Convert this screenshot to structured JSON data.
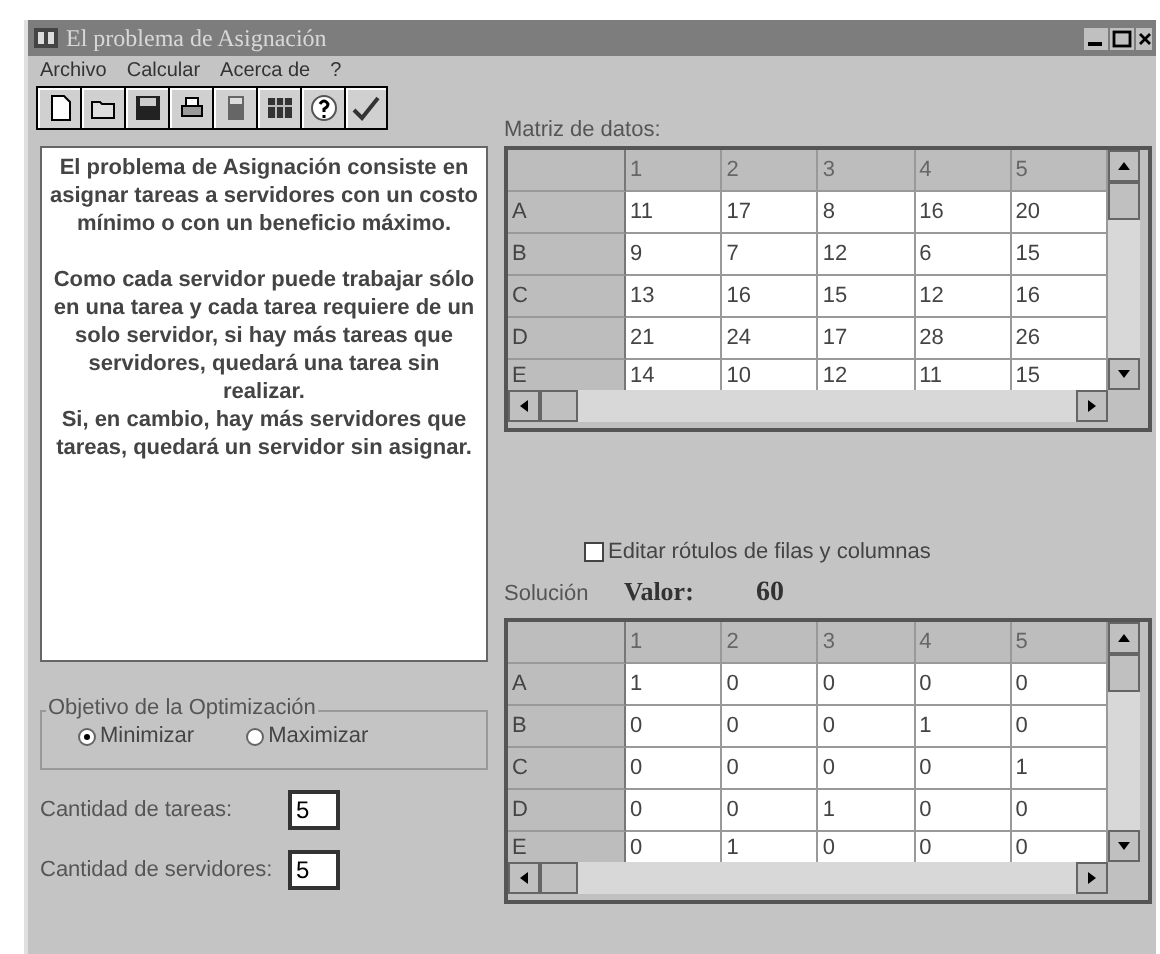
{
  "window": {
    "title": "El problema de Asignación"
  },
  "menu": [
    {
      "label": "Archivo"
    },
    {
      "label": "Calcular"
    },
    {
      "label": "Acerca de"
    },
    {
      "label": "?"
    }
  ],
  "toolbar": [
    {
      "kind": "new"
    },
    {
      "kind": "open"
    },
    {
      "kind": "save"
    },
    {
      "kind": "print"
    },
    {
      "kind": "calculator"
    },
    {
      "kind": "data"
    },
    {
      "kind": "help"
    },
    {
      "kind": "check"
    }
  ],
  "description": [
    "El problema de Asignación consiste en asignar tareas a servidores con un costo mínimo o con un beneficio máximo.",
    "Como cada servidor puede trabajar sólo en una tarea y cada tarea requiere de un solo servidor, si hay más tareas que servidores, quedará una tarea sin realizar.",
    "Si, en cambio, hay más servidores que tareas, quedará un servidor sin asignar."
  ],
  "objective": {
    "legend": "Objetivo de la Optimización",
    "options": [
      {
        "label": "Minimizar",
        "selected": true
      },
      {
        "label": "Maximizar",
        "selected": false
      }
    ]
  },
  "fields": [
    {
      "label": "Cantidad de tareas:",
      "value": "5"
    },
    {
      "label": "Cantidad de servidores:",
      "value": "5"
    }
  ],
  "data_matrix": {
    "label": "Matriz de datos:",
    "columns": [
      "1",
      "2",
      "3",
      "4",
      "5"
    ],
    "rows": [
      {
        "label": "A",
        "cells": [
          "11",
          "17",
          "8",
          "16",
          "20"
        ]
      },
      {
        "label": "B",
        "cells": [
          "9",
          "7",
          "12",
          "6",
          "15"
        ]
      },
      {
        "label": "C",
        "cells": [
          "13",
          "16",
          "15",
          "12",
          "16"
        ]
      },
      {
        "label": "D",
        "cells": [
          "21",
          "24",
          "17",
          "28",
          "26"
        ]
      },
      {
        "label": "E",
        "cells": [
          "14",
          "10",
          "12",
          "11",
          "15"
        ]
      }
    ]
  },
  "edit_labels": {
    "label": "Editar rótulos de filas y columnas",
    "checked": false
  },
  "solution": {
    "label": "Solución",
    "value_label": "Valor:",
    "value": "60",
    "columns": [
      "1",
      "2",
      "3",
      "4",
      "5"
    ],
    "rows": [
      {
        "label": "A",
        "cells": [
          "1",
          "0",
          "0",
          "0",
          "0"
        ]
      },
      {
        "label": "B",
        "cells": [
          "0",
          "0",
          "0",
          "1",
          "0"
        ]
      },
      {
        "label": "C",
        "cells": [
          "0",
          "0",
          "0",
          "0",
          "1"
        ]
      },
      {
        "label": "D",
        "cells": [
          "0",
          "0",
          "1",
          "0",
          "0"
        ]
      },
      {
        "label": "E",
        "cells": [
          "0",
          "1",
          "0",
          "0",
          "0"
        ]
      }
    ]
  }
}
